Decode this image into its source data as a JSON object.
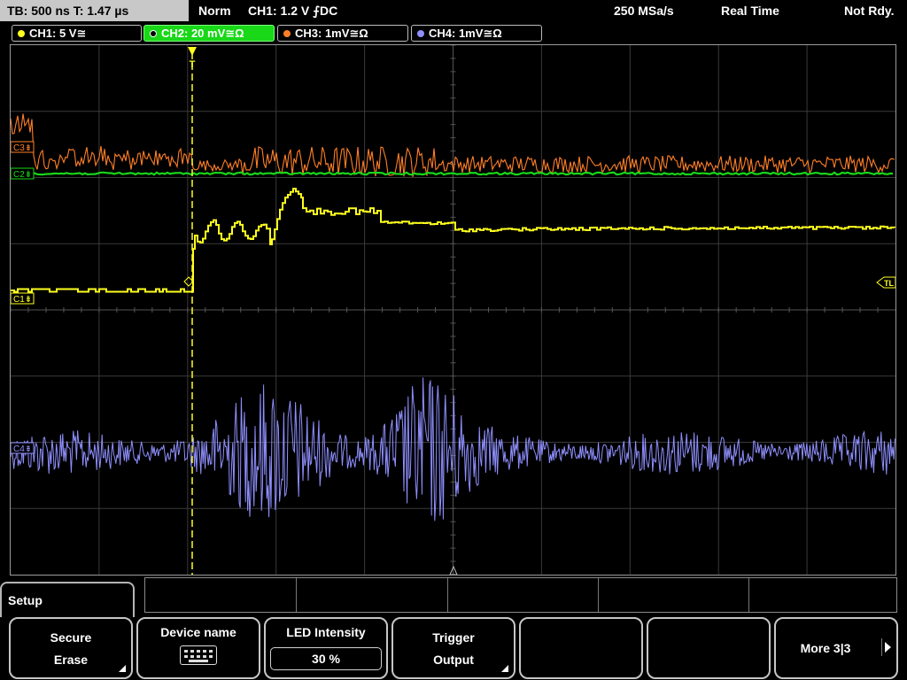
{
  "topbar": {
    "timebase": "TB: 500 ns  T: 1.47 µs",
    "mode": "Norm",
    "trigger": "CH1: 1.2 V ⨍DC",
    "sample_rate": "250 MSa/s",
    "acq": "Real Time",
    "state": "Not Rdy."
  },
  "channels": [
    {
      "label": "CH1: 5 V≅",
      "color": "#ffff1e",
      "active": false
    },
    {
      "label": "CH2: 20 mV≅Ω",
      "color": "#18d818",
      "active": true
    },
    {
      "label": "CH3: 1mV≅Ω",
      "color": "#ff7f27",
      "active": false
    },
    {
      "label": "CH4: 1mV≅Ω",
      "color": "#8f8fff",
      "active": false
    }
  ],
  "markers": {
    "c1": "C1⇟",
    "c2": "C2⇟",
    "c3": "C3⇟",
    "c4": "C4⇟",
    "trigger_level": "TL",
    "trigger_pos": "T"
  },
  "chart_data": {
    "type": "line",
    "title": "",
    "xlabel": "",
    "ylabel": "",
    "grid": true,
    "x_divisions": 10,
    "y_divisions": 8,
    "series": [
      {
        "name": "CH1",
        "color": "#ffff1e",
        "shape": "step-response"
      },
      {
        "name": "CH2",
        "color": "#18d818",
        "shape": "flat-noise"
      },
      {
        "name": "CH3",
        "color": "#ff7f27",
        "shape": "noise"
      },
      {
        "name": "CH4",
        "color": "#8f8fff",
        "shape": "oscillating-noise"
      }
    ]
  },
  "menu": {
    "setup_label": "Setup",
    "softkeys": [
      {
        "line1": "Secure",
        "line2": "Erase"
      },
      {
        "line1": "Device name"
      },
      {
        "line1": "LED Intensity",
        "value": "30 %"
      },
      {
        "line1": "Trigger",
        "line2": "Output"
      },
      {
        "line1": ""
      },
      {
        "line1": ""
      },
      {
        "line1": "More 3|3"
      }
    ]
  }
}
